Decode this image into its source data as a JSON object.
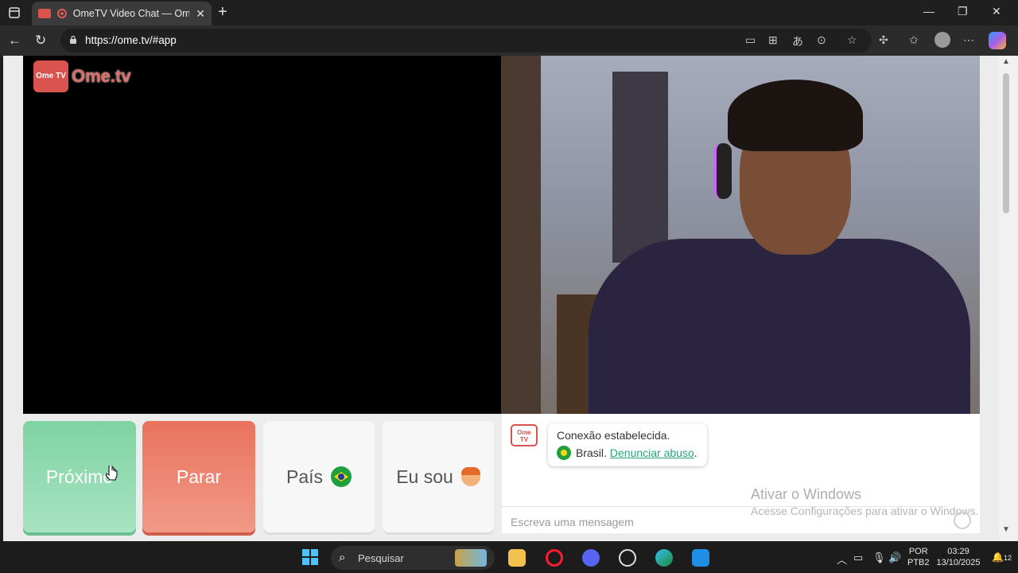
{
  "browser": {
    "tab_title": "OmeTV Video Chat — Omeg",
    "url": "https://ome.tv/#app"
  },
  "logo": {
    "tv_text": "Ome TV",
    "text": "Ome.tv"
  },
  "controls": {
    "next_label": "Próximo",
    "stop_label": "Parar",
    "country_label": "País",
    "iam_label": "Eu sou"
  },
  "chat": {
    "logo_text": "Ome TV",
    "status_message": "Conexão estabelecida.",
    "country": "Brasil.",
    "report_link": "Denunciar abuso",
    "input_placeholder": "Escreva uma mensagem"
  },
  "watermark": {
    "title": "Ativar o Windows",
    "subtitle": "Acesse Configurações para ativar o Windows."
  },
  "taskbar": {
    "search_placeholder": "Pesquisar",
    "lang_line1": "POR",
    "lang_line2": "PTB2",
    "time": "03:29",
    "date": "13/10/2025",
    "notification_count": "12"
  }
}
